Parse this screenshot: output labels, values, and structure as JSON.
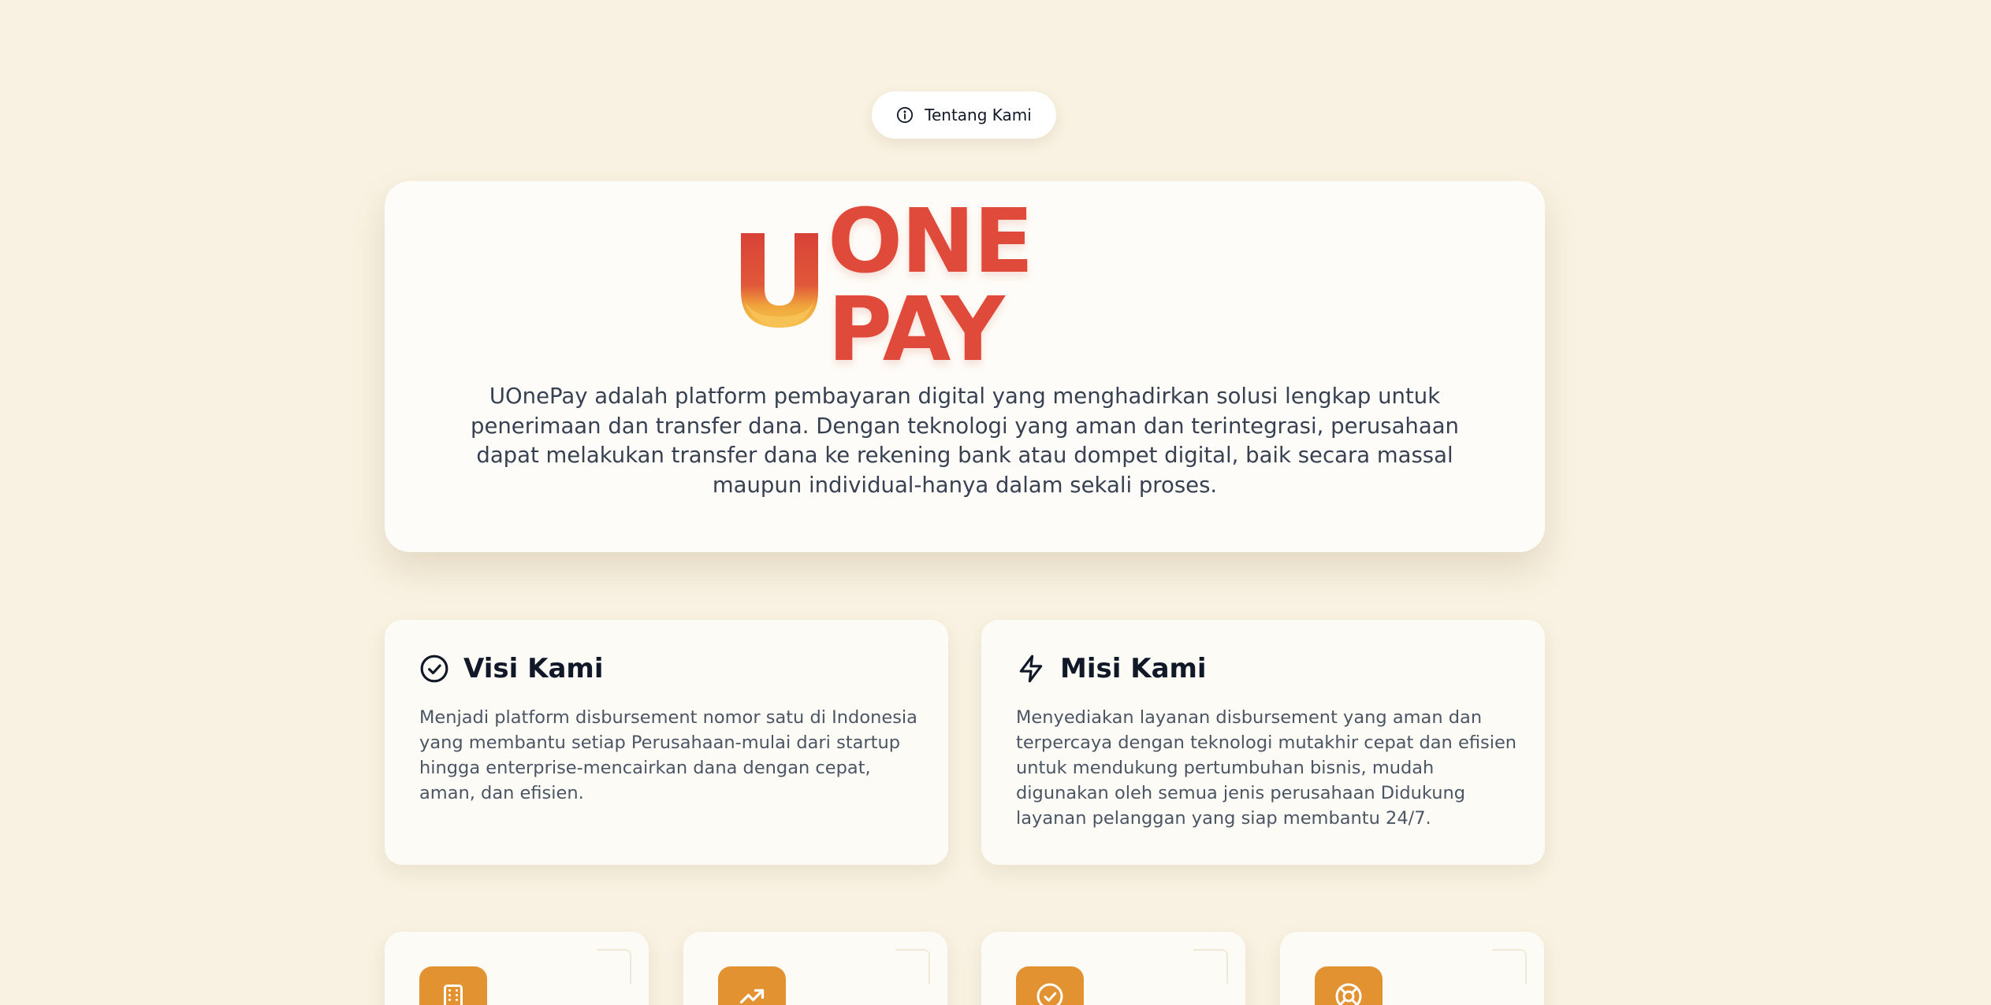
{
  "pill": {
    "label": "Tentang Kami",
    "icon": "info-icon"
  },
  "hero": {
    "logo_text": "ONE PAY",
    "description": "UOnePay adalah platform pembayaran digital yang menghadirkan solusi lengkap untuk penerimaan dan transfer dana. Dengan teknologi yang aman dan terintegrasi, perusahaan dapat melakukan transfer dana ke rekening bank atau dompet digital, baik secara massal maupun individual-hanya dalam sekali proses."
  },
  "vision": {
    "title": "Visi Kami",
    "icon": "check-circle-icon",
    "text": "Menjadi platform disbursement nomor satu di Indonesia yang membantu setiap Perusahaan-mulai dari startup hingga enterprise-mencairkan dana dengan cepat, aman, dan efisien."
  },
  "mission": {
    "title": "Misi Kami",
    "icon": "lightning-icon",
    "text": "Menyediakan layanan disbursement yang aman dan terpercaya dengan teknologi mutakhir cepat dan efisien untuk mendukung pertumbuhan bisnis, mudah digunakan oleh semua jenis perusahaan Didukung layanan pelanggan yang siap membantu 24/7."
  },
  "features": [
    {
      "icon": "building-icon"
    },
    {
      "icon": "trending-up-icon"
    },
    {
      "icon": "check-circle-icon"
    },
    {
      "icon": "support-icon"
    }
  ],
  "colors": {
    "background": "#f9f2e2",
    "brand_red": "#e04a3b",
    "brand_orange": "#e39232",
    "card": "#fefcf8"
  }
}
